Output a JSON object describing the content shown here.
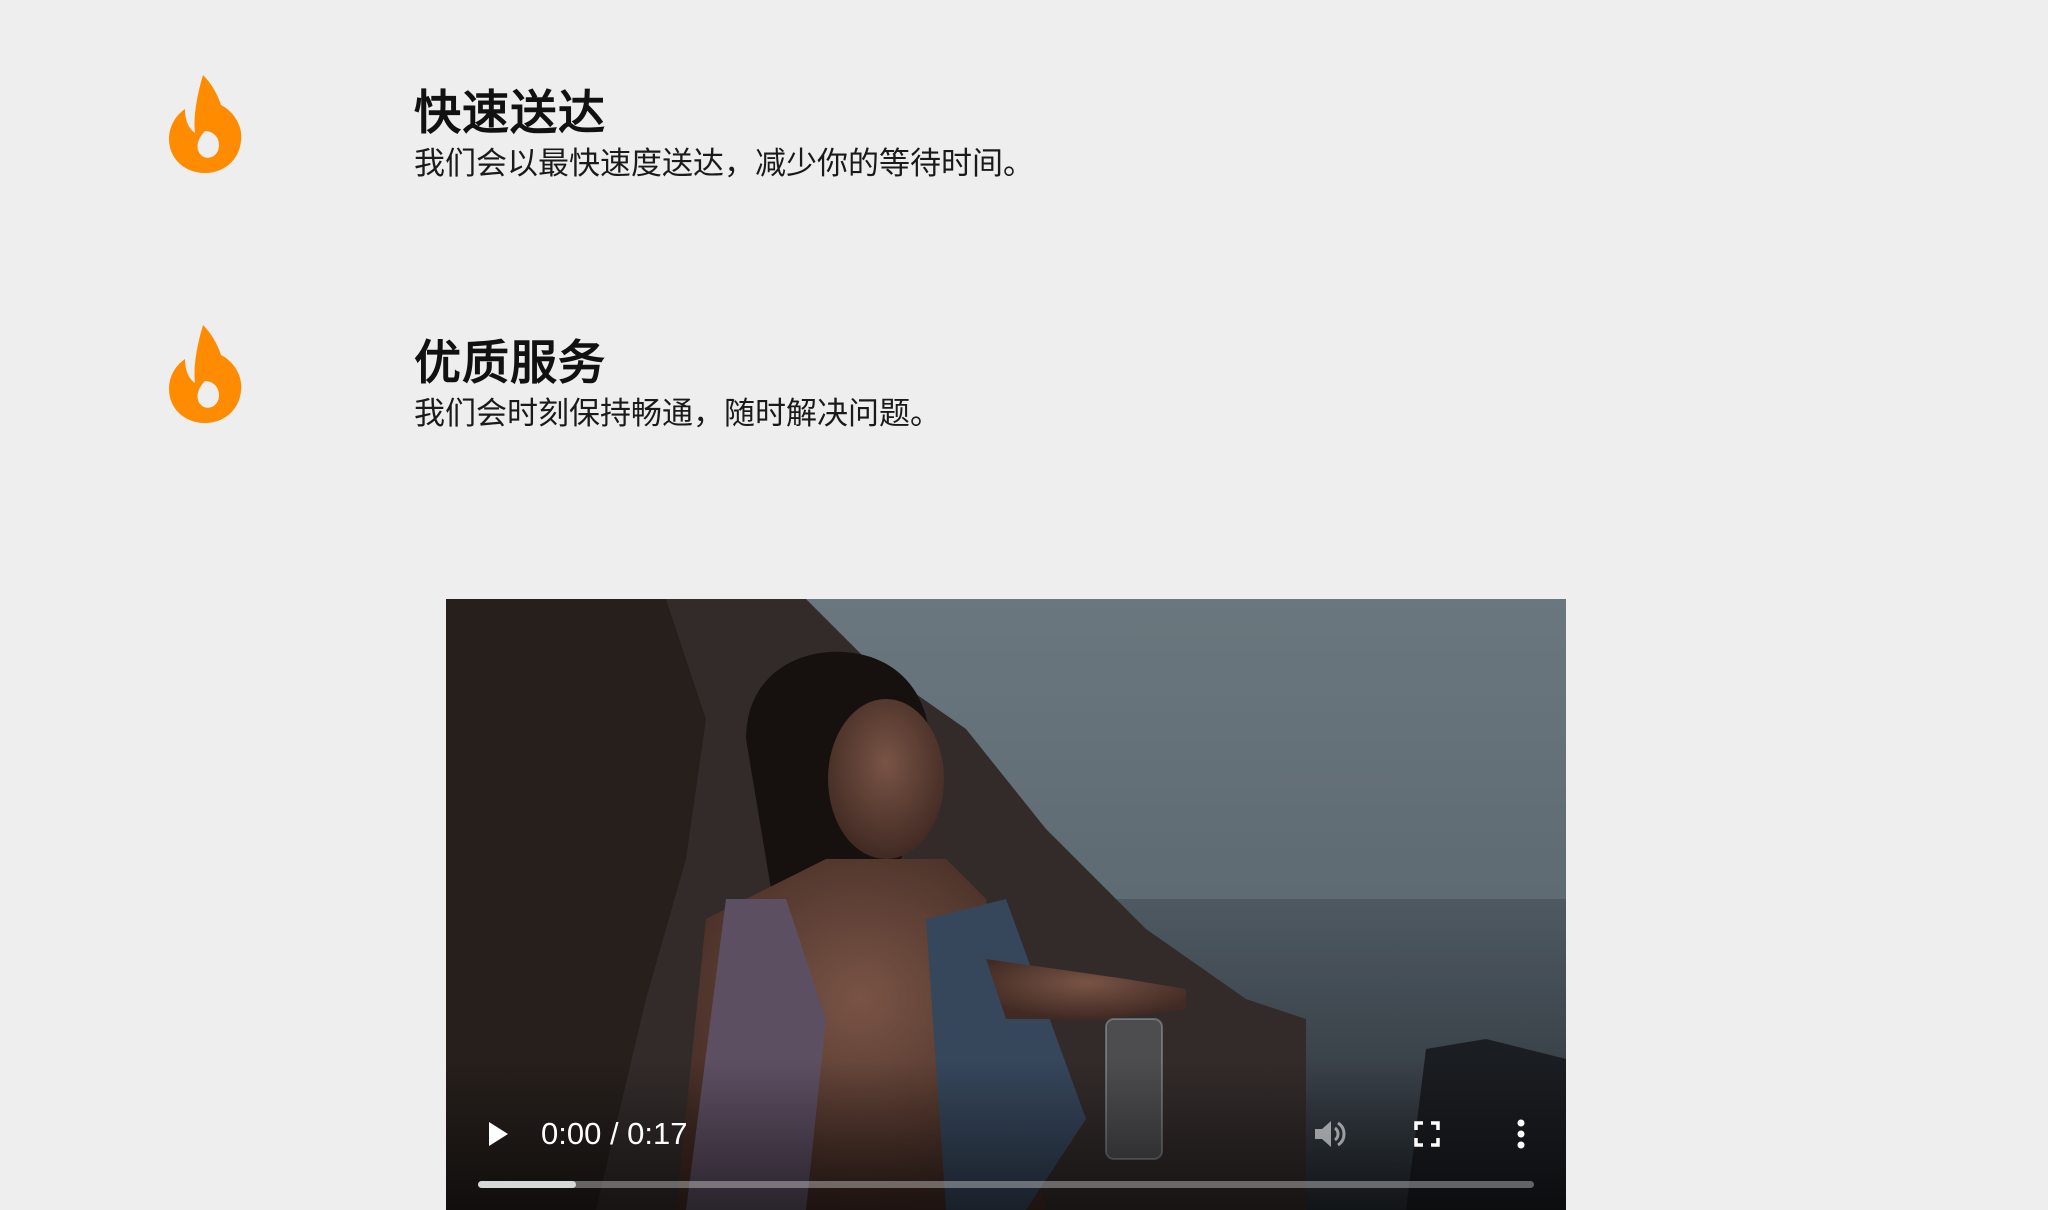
{
  "features": [
    {
      "icon": "flame-icon",
      "title": "快速送达",
      "description": "我们会以最快速度送达，减少你的等待时间。"
    },
    {
      "icon": "flame-icon",
      "title": "优质服务",
      "description": "我们会时刻保持畅通，随时解决问题。"
    }
  ],
  "video": {
    "time_display": "0:00 / 0:17",
    "buffered_fraction": 0.093,
    "controls": {
      "play": "play-icon",
      "volume": "volume-icon",
      "fullscreen": "fullscreen-icon",
      "more": "more-vertical-icon"
    }
  },
  "colors": {
    "accent": "#ff8c00",
    "background": "#eeeeee"
  }
}
